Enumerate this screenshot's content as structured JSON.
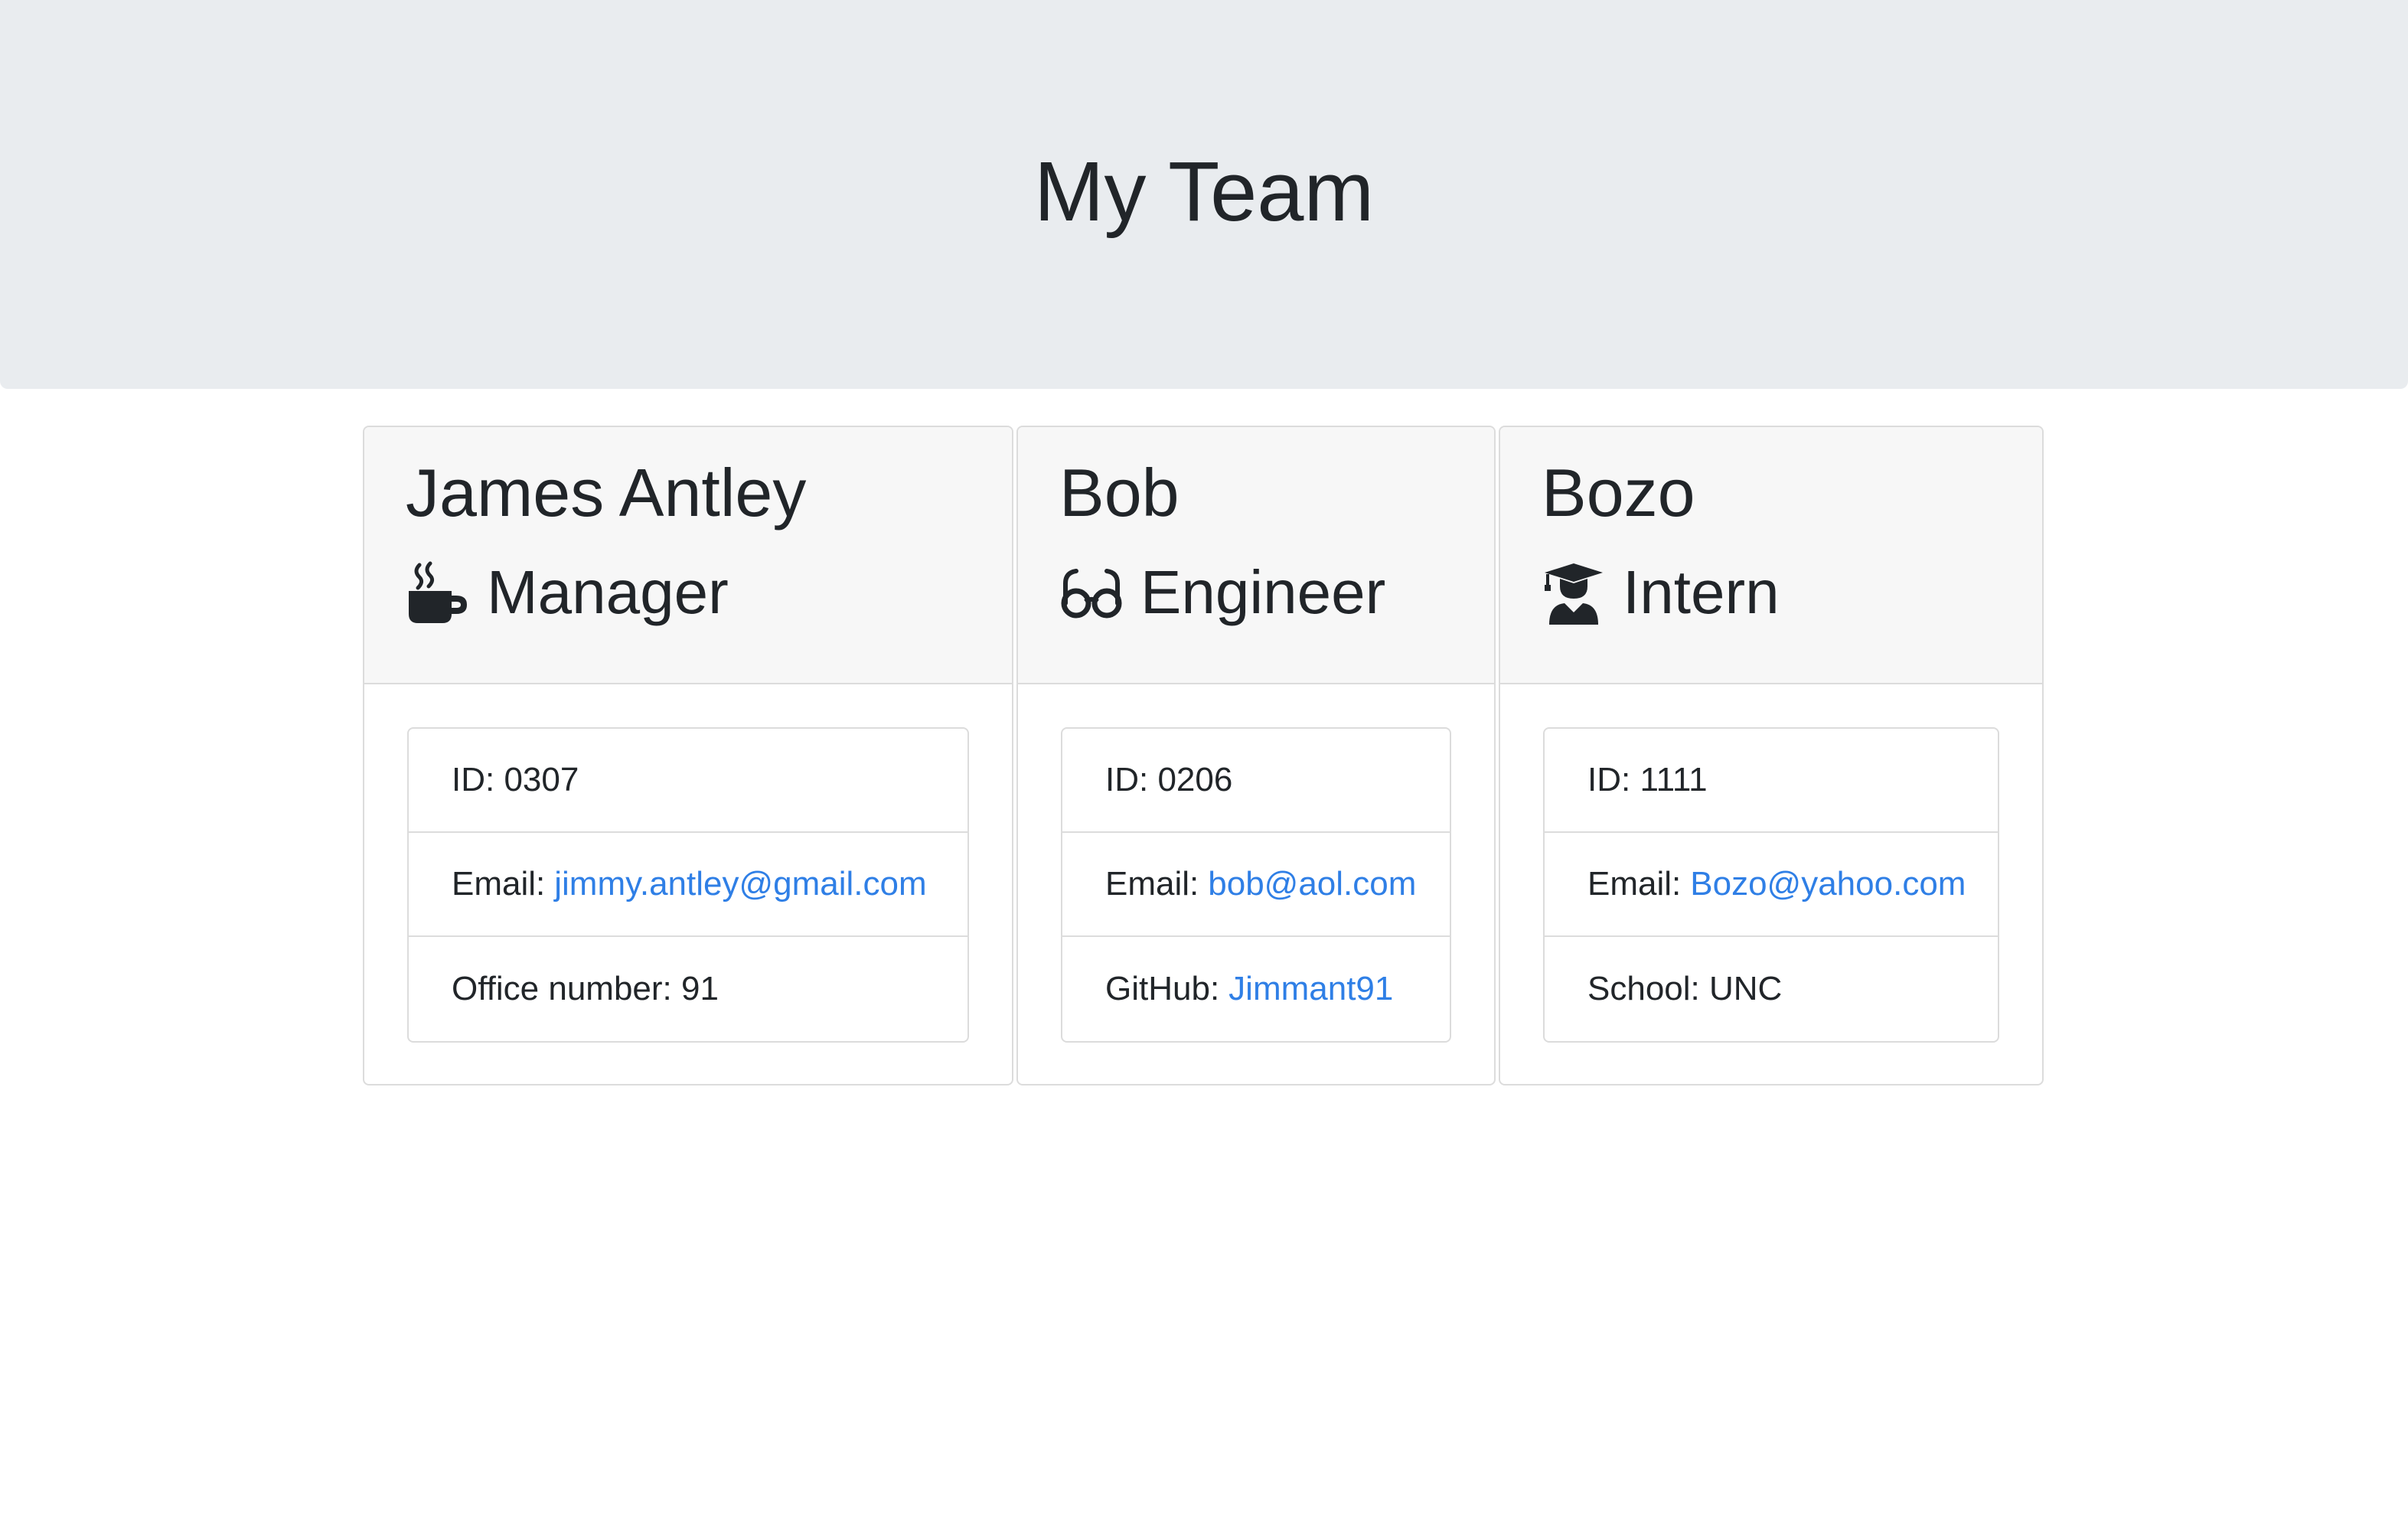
{
  "header": {
    "title": "My Team"
  },
  "team": [
    {
      "name": "James Antley",
      "role": "Manager",
      "role_icon": "coffee-mug-icon",
      "id_label": "ID: 0307",
      "email_prefix": "Email:",
      "email": "jimmy.antley@gmail.com",
      "extra_label": "Office number: 91"
    },
    {
      "name": "Bob",
      "role": "Engineer",
      "role_icon": "glasses-icon",
      "id_label": "ID: 0206",
      "email_prefix": "Email:",
      "email": "bob@aol.com",
      "extra_prefix": "GitHub:",
      "extra_link": "Jimmant91"
    },
    {
      "name": "Bozo",
      "role": "Intern",
      "role_icon": "graduate-icon",
      "id_label": "ID: 1111",
      "email_prefix": "Email:",
      "email": "Bozo@yahoo.com",
      "extra_label": "School: UNC"
    }
  ],
  "colors": {
    "link": "#2f7fe6",
    "jumbotron_bg": "#e9ecef",
    "card_header_bg": "#f7f7f7",
    "text": "#212529"
  }
}
